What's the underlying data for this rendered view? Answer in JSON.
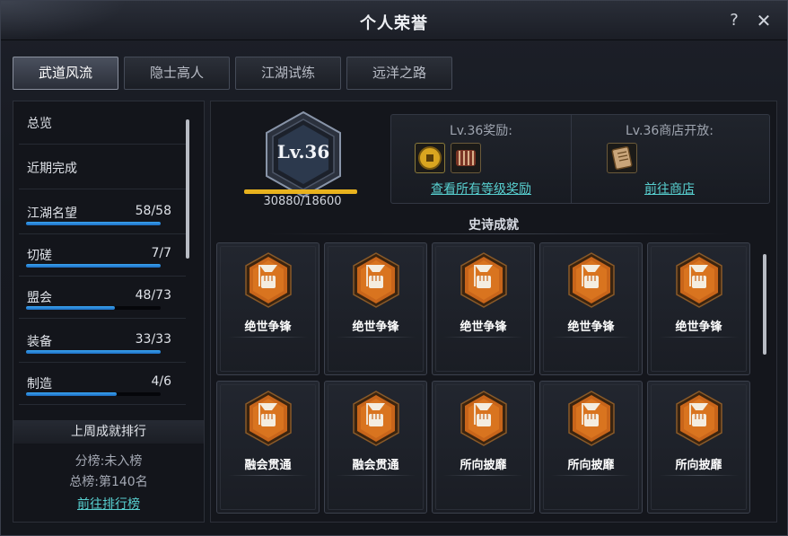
{
  "window": {
    "title": "个人荣誉",
    "help": "?",
    "close": "✕"
  },
  "tabs": [
    {
      "label": "武道风流",
      "active": true
    },
    {
      "label": "隐士高人",
      "active": false
    },
    {
      "label": "江湖试练",
      "active": false
    },
    {
      "label": "远洋之路",
      "active": false
    }
  ],
  "sidebar": {
    "items": [
      {
        "label": "总览"
      },
      {
        "label": "近期完成"
      },
      {
        "label": "江湖名望",
        "count": "58/58",
        "progress": 1.0
      },
      {
        "label": "切磋",
        "count": "7/7",
        "progress": 1.0
      },
      {
        "label": "盟会",
        "count": "48/73",
        "progress": 0.66
      },
      {
        "label": "装备",
        "count": "33/33",
        "progress": 1.0
      },
      {
        "label": "制造",
        "count": "4/6",
        "progress": 0.67
      }
    ],
    "ranking": {
      "title": "上周成就排行",
      "sub_rank": "分榜:未入榜",
      "total_rank": "总榜:第140名",
      "link": "前往排行榜"
    }
  },
  "level": {
    "label": "Lv.36",
    "xp": "30880/18600",
    "xp_progress": 1.0,
    "accent": "#e8b21e"
  },
  "rewards": {
    "left": {
      "title": "Lv.36奖励:",
      "link": "查看所有等级奖励",
      "icons": [
        "gold-coin-icon",
        "scroll-bundle-icon"
      ]
    },
    "right": {
      "title": "Lv.36商店开放:",
      "link": "前往商店",
      "icons": [
        "book-icon"
      ]
    }
  },
  "epic": {
    "header": "史诗成就",
    "cards": [
      {
        "label": "绝世争锋",
        "icon": "flag-fist-icon"
      },
      {
        "label": "绝世争锋",
        "icon": "flag-fist-icon"
      },
      {
        "label": "绝世争锋",
        "icon": "flag-fist-icon"
      },
      {
        "label": "绝世争锋",
        "icon": "flag-fist-icon"
      },
      {
        "label": "绝世争锋",
        "icon": "flag-fist-icon"
      },
      {
        "label": "融会贯通",
        "icon": "flag-fist-icon"
      },
      {
        "label": "融会贯通",
        "icon": "flag-fist-icon"
      },
      {
        "label": "所向披靡",
        "icon": "flag-fist-icon"
      },
      {
        "label": "所向披靡",
        "icon": "flag-fist-icon"
      },
      {
        "label": "所向披靡",
        "icon": "flag-fist-icon"
      }
    ]
  },
  "colors": {
    "link": "#58d0d0",
    "progress": "#2a8ee0",
    "badge_orange": "#d9731e"
  }
}
